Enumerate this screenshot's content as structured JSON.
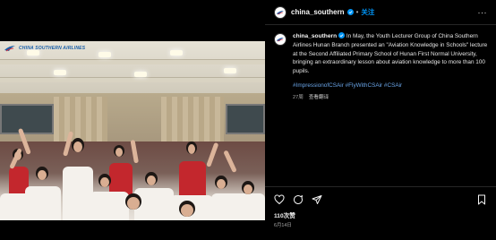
{
  "post": {
    "username": "china_southern",
    "follow_label": "关注",
    "more_label": "···",
    "caption_text": "In May, the Youth Lecturer Group of China Southern Airlines Hunan Branch presented an \"Aviation Knowledge in Schools\" lecture at the Second Affiliated Primary School of Hunan First Normal University, bringing an extraordinary lesson about aviation knowledge to more than 100 pupils.",
    "hashtags": "#ImpressionofCSAir #FlyWithCSAir #CSAir",
    "caption_age": "27周",
    "see_translation": "查看翻译",
    "likes": "110次赞",
    "date": "6月14日"
  },
  "photo": {
    "logo_text": "CHINA SOUTHERN AIRLINES"
  },
  "icons": {
    "like": "heart-icon",
    "comment": "comment-icon",
    "share": "share-icon",
    "save": "bookmark-icon",
    "verified": "verified-badge-icon"
  },
  "colors": {
    "background": "#000000",
    "link": "#0095f6",
    "hashtag": "#6aa5e8",
    "verified": "#0095f6",
    "airline_blue": "#1a5fa8"
  }
}
